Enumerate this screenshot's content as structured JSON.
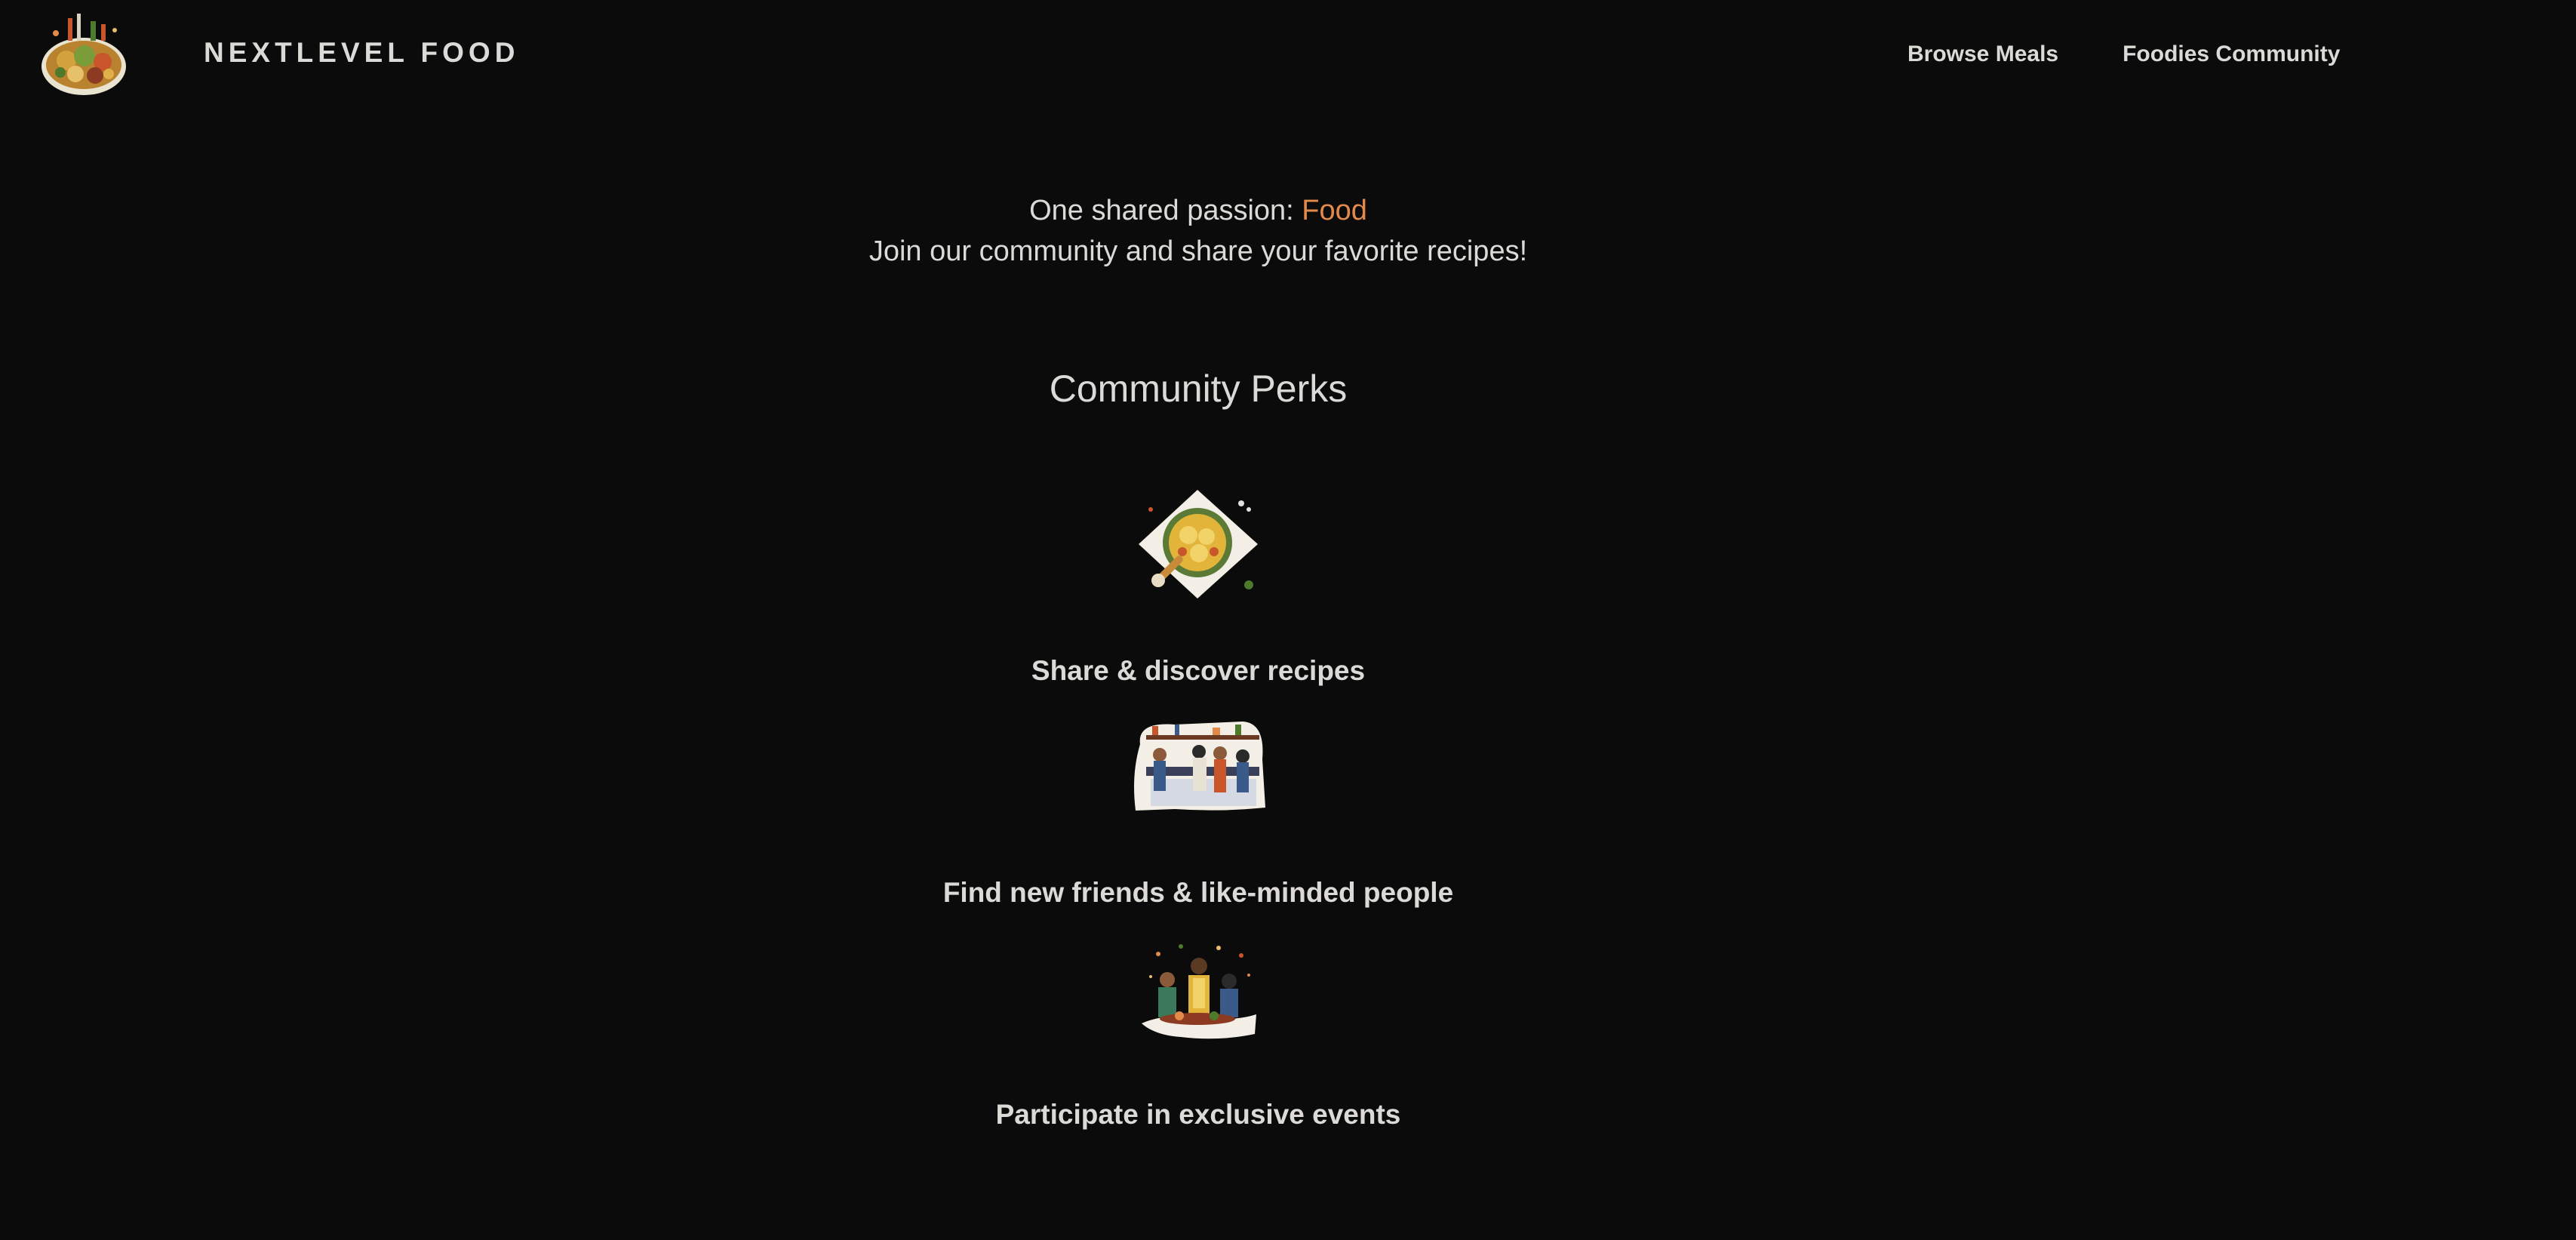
{
  "header": {
    "brand": "NEXTLEVEL FOOD",
    "logo_icon": "food-platter-logo",
    "nav": [
      {
        "label": "Browse Meals"
      },
      {
        "label": "Foodies Community"
      }
    ]
  },
  "hero": {
    "line1_prefix": "One shared passion: ",
    "line1_accent": "Food",
    "line2": "Join our community and share your favorite recipes!"
  },
  "perks": {
    "title": "Community Perks",
    "items": [
      {
        "label": "Share & discover recipes",
        "icon": "recipe-plate-illustration"
      },
      {
        "label": "Find new friends & like-minded people",
        "icon": "community-kitchen-illustration"
      },
      {
        "label": "Participate in exclusive events",
        "icon": "cooking-event-illustration"
      }
    ]
  },
  "colors": {
    "background": "#0b0b0b",
    "text": "#dcdad6",
    "accent": "#e38a4a"
  }
}
